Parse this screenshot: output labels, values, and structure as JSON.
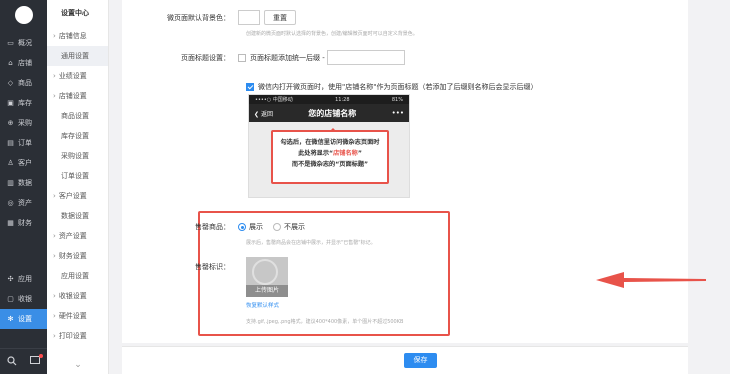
{
  "rail": {
    "items": [
      {
        "icon": "overview-icon",
        "glyph": "▭",
        "label": "概况"
      },
      {
        "icon": "store-icon",
        "glyph": "⌂",
        "label": "店铺"
      },
      {
        "icon": "tag-icon",
        "glyph": "◇",
        "label": "商品"
      },
      {
        "icon": "box-icon",
        "glyph": "▣",
        "label": "库存"
      },
      {
        "icon": "cart-icon",
        "glyph": "⊕",
        "label": "采购"
      },
      {
        "icon": "order-icon",
        "glyph": "▤",
        "label": "订单"
      },
      {
        "icon": "user-icon",
        "glyph": "♙",
        "label": "客户"
      },
      {
        "icon": "chart-icon",
        "glyph": "▥",
        "label": "数据"
      },
      {
        "icon": "asset-icon",
        "glyph": "◎",
        "label": "资产"
      },
      {
        "icon": "finance-icon",
        "glyph": "▦",
        "label": "财务"
      }
    ],
    "bottom_items": [
      {
        "icon": "apps-icon",
        "glyph": "✣",
        "label": "应用"
      },
      {
        "icon": "cashier-icon",
        "glyph": "▢",
        "label": "收银"
      },
      {
        "icon": "gear-icon",
        "glyph": "✻",
        "label": "设置"
      }
    ]
  },
  "menu": {
    "title": "设置中心",
    "items": [
      {
        "label": "店铺信息",
        "group": true
      },
      {
        "label": "通用设置",
        "group": false,
        "selected": true
      },
      {
        "label": "业绩设置",
        "group": true
      },
      {
        "label": "店铺设置",
        "group": true
      },
      {
        "label": "商品设置",
        "group": false
      },
      {
        "label": "库存设置",
        "group": false
      },
      {
        "label": "采购设置",
        "group": false
      },
      {
        "label": "订单设置",
        "group": false
      },
      {
        "label": "客户设置",
        "group": true
      },
      {
        "label": "数据设置",
        "group": false
      },
      {
        "label": "资产设置",
        "group": true
      },
      {
        "label": "财务设置",
        "group": true
      },
      {
        "label": "应用设置",
        "group": false
      },
      {
        "label": "收银设置",
        "group": true
      },
      {
        "label": "硬件设置",
        "group": true
      },
      {
        "label": "打印设置",
        "group": true
      }
    ]
  },
  "settings": {
    "bg_label": "微页面默认背景色：",
    "reset_label": "重置",
    "bg_help": "创建新的微页面时默认选择的背景色，创建/编辑微页面时可以自定义背景色。",
    "title_label": "页面标题设置：",
    "title_suffix_label": "页面标题添加统一后缀 -",
    "title_suffix_value": "",
    "shopname_label": "微信内打开微页面时，使用\"店铺名称\"作为页面标题（若添加了后缀则名称后会显示后缀）"
  },
  "phone": {
    "carrier": "••••○ 中国移动 ",
    "time": "11:28",
    "battery": "81%",
    "back_label": "返回",
    "shop_name": "您的店铺名称",
    "more": "•••",
    "callout_line1": "勾选后，在微信里访问微杂志页面时",
    "callout_line2_a": "此处将显示“",
    "callout_line2_hl": "店铺名称",
    "callout_line2_b": "”",
    "callout_line3": "而不是微杂志的“页面标题”"
  },
  "soldout": {
    "goods_label": "售罄商品：",
    "option_show": "展示",
    "option_hide": "不展示",
    "goods_help": "展示后，售罄商品会在店铺中展示，并显示\"已售罄\"标记。",
    "mark_label": "售罄标识：",
    "upload_label": "上传图片",
    "reset_style": "恢复默认样式",
    "mark_help": "支持.gif,.jpeg,.png格式，建议400*400像素，单个图片不超过500KB"
  },
  "footer": {
    "save_label": "保存"
  },
  "colors": {
    "accent": "#2d8cf0",
    "highlight": "#e8534a",
    "rail_bg": "#2b2f36"
  }
}
